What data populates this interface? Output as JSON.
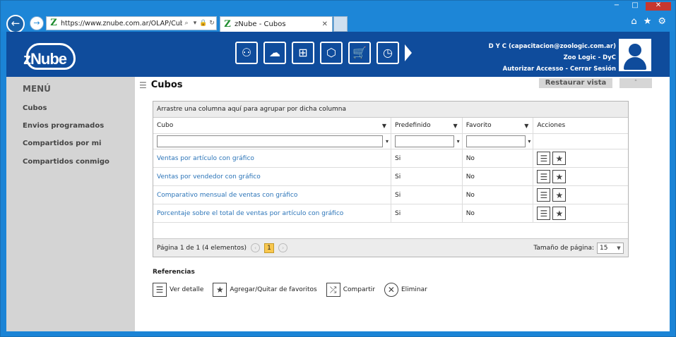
{
  "browser": {
    "url": "https://www.znube.com.ar/OLAP/Cub",
    "tab_title": "zNube - Cubos",
    "window_controls": [
      "−",
      "□",
      "✕"
    ]
  },
  "header": {
    "logo_text": "zNube",
    "toolbar_icons": [
      "cubes-icon",
      "cloud-settings-icon",
      "pivot-icon",
      "cube-icon",
      "cart-icon",
      "clock-icon"
    ],
    "user_line1": "D Y C (capacitacion@zoologic.com.ar)",
    "user_line2": "Zoo Logic - DyC",
    "authorize": "Autorizar Accesso",
    "separator": " - ",
    "logout": "Cerrar Sesión"
  },
  "sidebar": {
    "title": "MENÚ",
    "items": [
      {
        "label": "Cubos"
      },
      {
        "label": "Envios programados"
      },
      {
        "label": "Compartidos por mi"
      },
      {
        "label": "Compartidos conmigo"
      }
    ]
  },
  "main": {
    "title": "Cubos",
    "restore_view": "Restaurar vista",
    "group_hint": "Arrastre una columna aquí para agrupar por dicha columna",
    "columns": [
      "Cubo",
      "Predefinido",
      "Favorito",
      "Acciones"
    ],
    "rows": [
      {
        "cubo": "Ventas por artículo con gráfico",
        "predefinido": "Si",
        "favorito": "No"
      },
      {
        "cubo": "Ventas por vendedor con gráfico",
        "predefinido": "Si",
        "favorito": "No"
      },
      {
        "cubo": "Comparativo mensual de ventas con gráfico",
        "predefinido": "Si",
        "favorito": "No"
      },
      {
        "cubo": "Porcentaje sobre el total de ventas por artículo con gráfico",
        "predefinido": "Si",
        "favorito": "No"
      }
    ],
    "pager": {
      "info": "Página 1 de 1 (4 elementos)",
      "current_page": "1",
      "page_size_label": "Tamaño de página:",
      "page_size": "15"
    }
  },
  "references": {
    "title": "Referencias",
    "items": [
      {
        "label": "Ver detalle",
        "icon": "list-icon"
      },
      {
        "label": "Agregar/Quitar de favoritos",
        "icon": "star-icon"
      },
      {
        "label": "Compartir",
        "icon": "share-icon"
      },
      {
        "label": "Eliminar",
        "icon": "delete-icon"
      }
    ]
  }
}
